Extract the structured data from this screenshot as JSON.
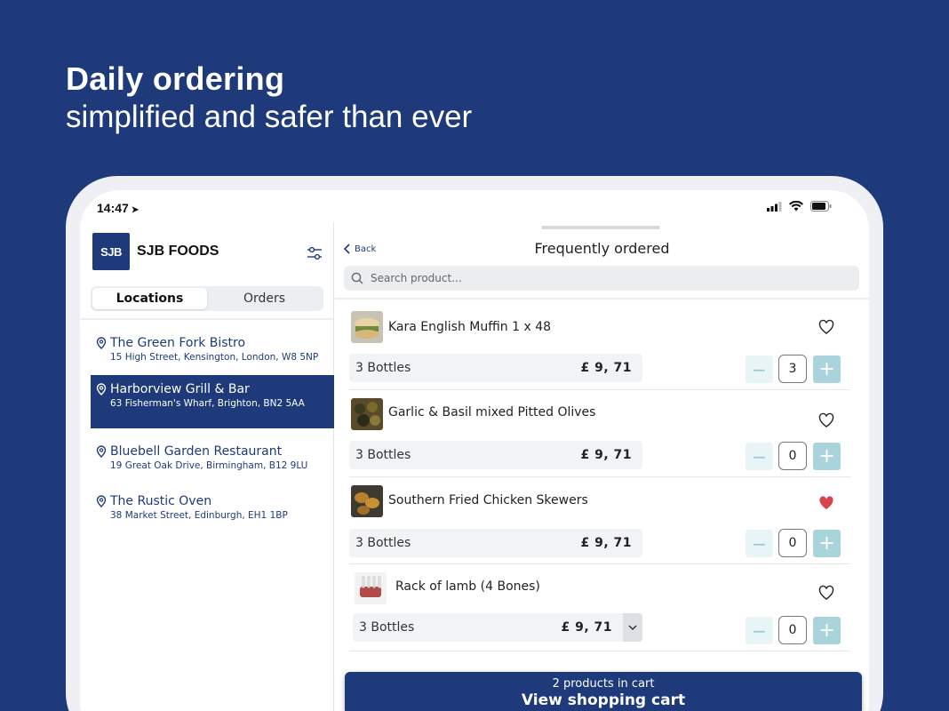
{
  "headline": {
    "title": "Daily ordering",
    "subtitle": "simplified and safer than ever"
  },
  "status_bar": {
    "time": "14:47"
  },
  "brand": {
    "logo_text": "SJB",
    "name": "SJB FOODS"
  },
  "segments": {
    "locations": "Locations",
    "orders": "Orders",
    "active": "Locations"
  },
  "locations": [
    {
      "name": "The Green Fork Bistro",
      "address": "15 High Street, Kensington, London, W8 5NP",
      "selected": false
    },
    {
      "name": "Harborview Grill & Bar",
      "address": "63 Fisherman's Wharf, Brighton, BN2 5AA",
      "selected": true
    },
    {
      "name": "Bluebell Garden Restaurant",
      "address": "19 Great Oak Drive, Birmingham, B12 9LU",
      "selected": false
    },
    {
      "name": "The Rustic Oven",
      "address": "38 Market Street, Edinburgh, EH1 1BP",
      "selected": false
    }
  ],
  "page": {
    "back_label": "Back",
    "title": "Frequently ordered"
  },
  "search": {
    "placeholder": "Search product..."
  },
  "products": [
    {
      "name": "Kara English Muffin 1 x 48",
      "unit": "3 Bottles",
      "price": "£ 9, 71",
      "quantity": "3",
      "favorite": false
    },
    {
      "name": "Garlic & Basil mixed Pitted Olives",
      "unit": "3 Bottles",
      "price": "£ 9, 71",
      "quantity": "0",
      "favorite": false
    },
    {
      "name": "Southern Fried Chicken Skewers",
      "unit": "3 Bottles",
      "price": "£ 9, 71",
      "quantity": "0",
      "favorite": true
    },
    {
      "name": "Rack of lamb (4 Bones)",
      "unit": "3 Bottles",
      "price": "£ 9, 71",
      "quantity": "0",
      "favorite": false
    }
  ],
  "cart": {
    "count_text": "2 products in cart",
    "button_label": "View shopping cart"
  },
  "colors": {
    "brand_navy": "#1e3a7a",
    "heart_red": "#d9424f",
    "plus_teal": "#a9d4dc"
  }
}
